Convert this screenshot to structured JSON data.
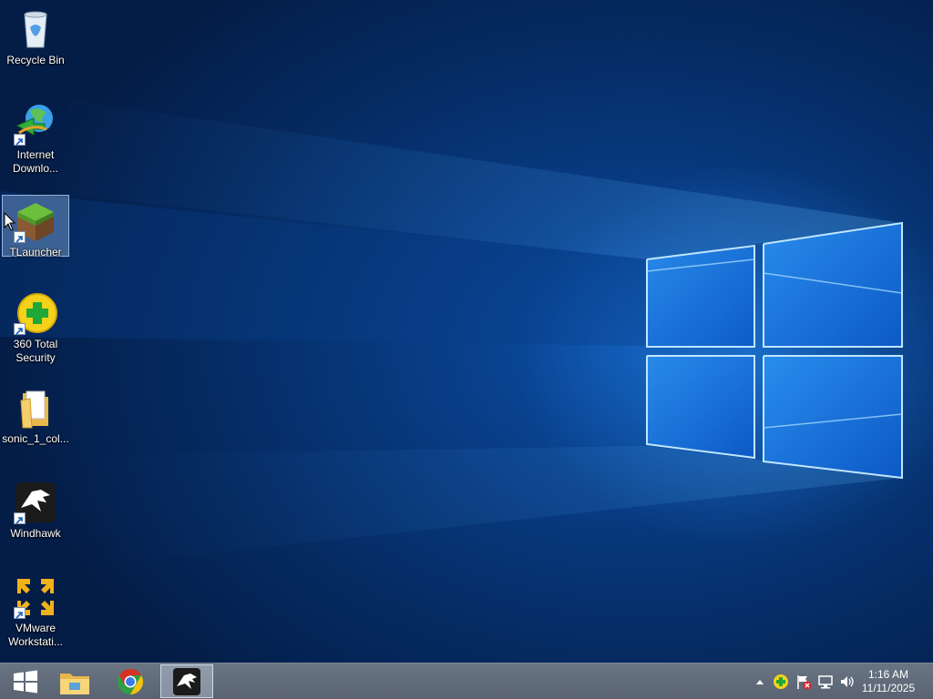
{
  "desktop_icons": [
    {
      "id": "recycle-bin",
      "label": "Recycle Bin"
    },
    {
      "id": "internet-download-manager",
      "label": "Internet\nDownlo..."
    },
    {
      "id": "tlauncher",
      "label": "TLauncher",
      "selected": true
    },
    {
      "id": "360-total-security",
      "label": "360 Total\nSecurity"
    },
    {
      "id": "sonic-folder",
      "label": "sonic_1_col..."
    },
    {
      "id": "windhawk",
      "label": "Windhawk"
    },
    {
      "id": "vmware-workstation",
      "label": "VMware\nWorkstati..."
    }
  ],
  "taskbar": {
    "buttons": [
      "start-icon",
      "file-explorer-icon",
      "chrome-icon",
      "windhawk-icon"
    ],
    "active_button": "windhawk-icon"
  },
  "tray": {
    "icons": [
      "show-hidden-icons-arrow",
      "360-security-tray-icon",
      "action-center-flag-icon",
      "network-icon",
      "volume-icon"
    ]
  },
  "clock": {
    "time": "1:16 AM",
    "date": "11/11/2025"
  },
  "colors": {
    "taskbar": "#5f6a79",
    "desktop": "#0b4ea6"
  }
}
